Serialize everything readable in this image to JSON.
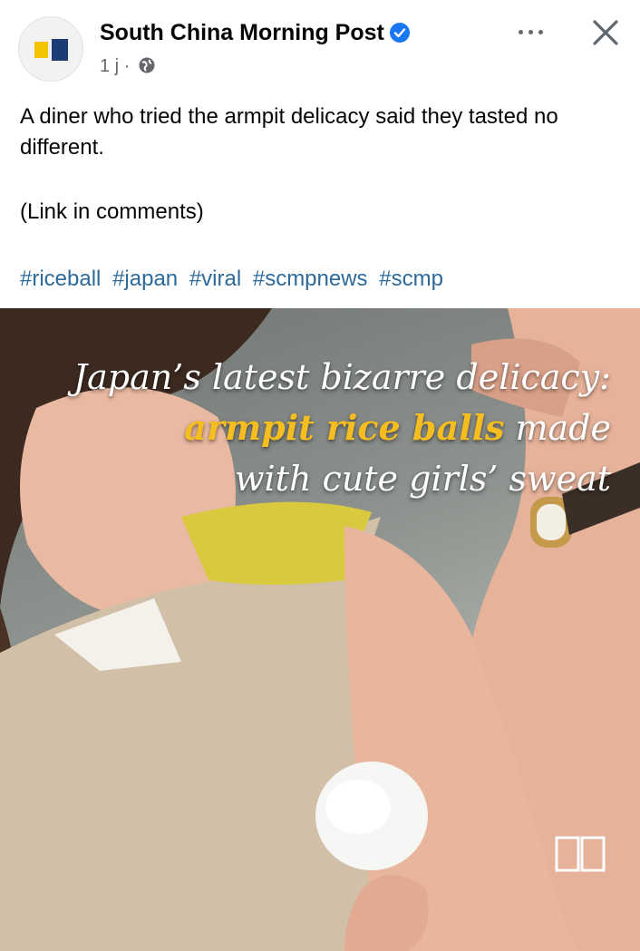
{
  "post": {
    "page_name": "South China Morning Post",
    "time": "1 j",
    "time_sep": "·",
    "text": "A diner who tried the armpit delicacy said they tasted no different.",
    "link_note": "(Link in comments)",
    "hashtags": [
      "#riceball",
      "#japan",
      "#viral",
      "#scmpnews",
      "#scmp"
    ]
  },
  "image": {
    "line1": "Japan’s latest bizarre delicacy:",
    "line2_highlight": "armpit rice balls",
    "line2_rest": " made",
    "line3": "with cute girls’ sweat"
  },
  "colors": {
    "verified_badge": "#1877f2",
    "hashtag": "#2d6a9a",
    "highlight": "#f5bd1f",
    "logo_yellow": "#f5c400",
    "logo_blue": "#1b3c74"
  },
  "icons": [
    "verified-badge-icon",
    "globe-icon",
    "more-options-icon",
    "close-icon",
    "book-icon"
  ]
}
